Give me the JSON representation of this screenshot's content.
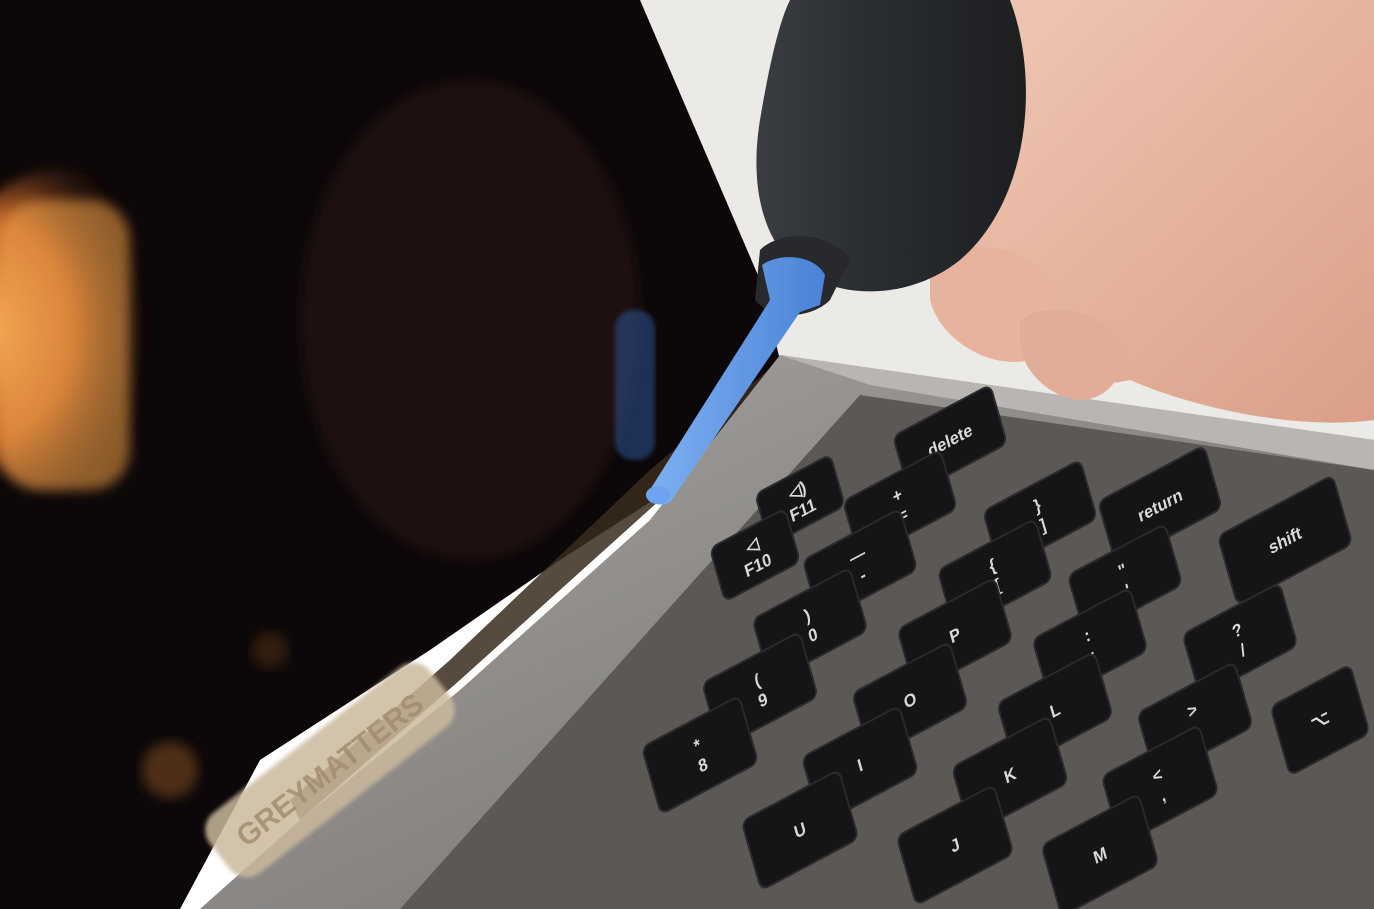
{
  "scene": {
    "description_tags": [
      "laptop",
      "keyboard",
      "air-blower",
      "hand",
      "screen-reflection"
    ],
    "colors": {
      "background": "#ffffff",
      "screen": "#0c0708",
      "warm_glow": "#f0a04a",
      "chassis": "#8e8b89",
      "key": "#151517",
      "blower_bulb": "#2a2c2f",
      "nozzle": "#5e97e8",
      "skin": "#e9bca8",
      "sticker": "#cbb99d"
    }
  },
  "keyboard": {
    "keys": [
      {
        "main": "delete"
      },
      {
        "main": "return"
      },
      {
        "main": "shift"
      },
      {
        "main": "+",
        "sub": "="
      },
      {
        "main": "}",
        "sub": "]"
      },
      {
        "main": "—",
        "sub": "-"
      },
      {
        "main": "{",
        "sub": "["
      },
      {
        "main": "\"",
        "sub": "'"
      },
      {
        "main": "?",
        "sub": "/"
      },
      {
        "main": ")",
        "sub": "0"
      },
      {
        "main": "P"
      },
      {
        "main": ":",
        "sub": ";"
      },
      {
        "main": "(",
        "sub": "9"
      },
      {
        "main": "O"
      },
      {
        "main": "L"
      },
      {
        "main": ">",
        "sub": "."
      },
      {
        "main": "*",
        "sub": "8"
      },
      {
        "main": "I"
      },
      {
        "main": "K"
      },
      {
        "main": "<",
        "sub": ","
      },
      {
        "main": "U"
      },
      {
        "main": "J"
      },
      {
        "main": "M"
      },
      {
        "main": "⌥"
      },
      {
        "main": "◁)",
        "sub": "F11"
      },
      {
        "main": "◁",
        "sub": "F10"
      }
    ]
  },
  "sticker": {
    "text": "GREYMATTERS"
  }
}
